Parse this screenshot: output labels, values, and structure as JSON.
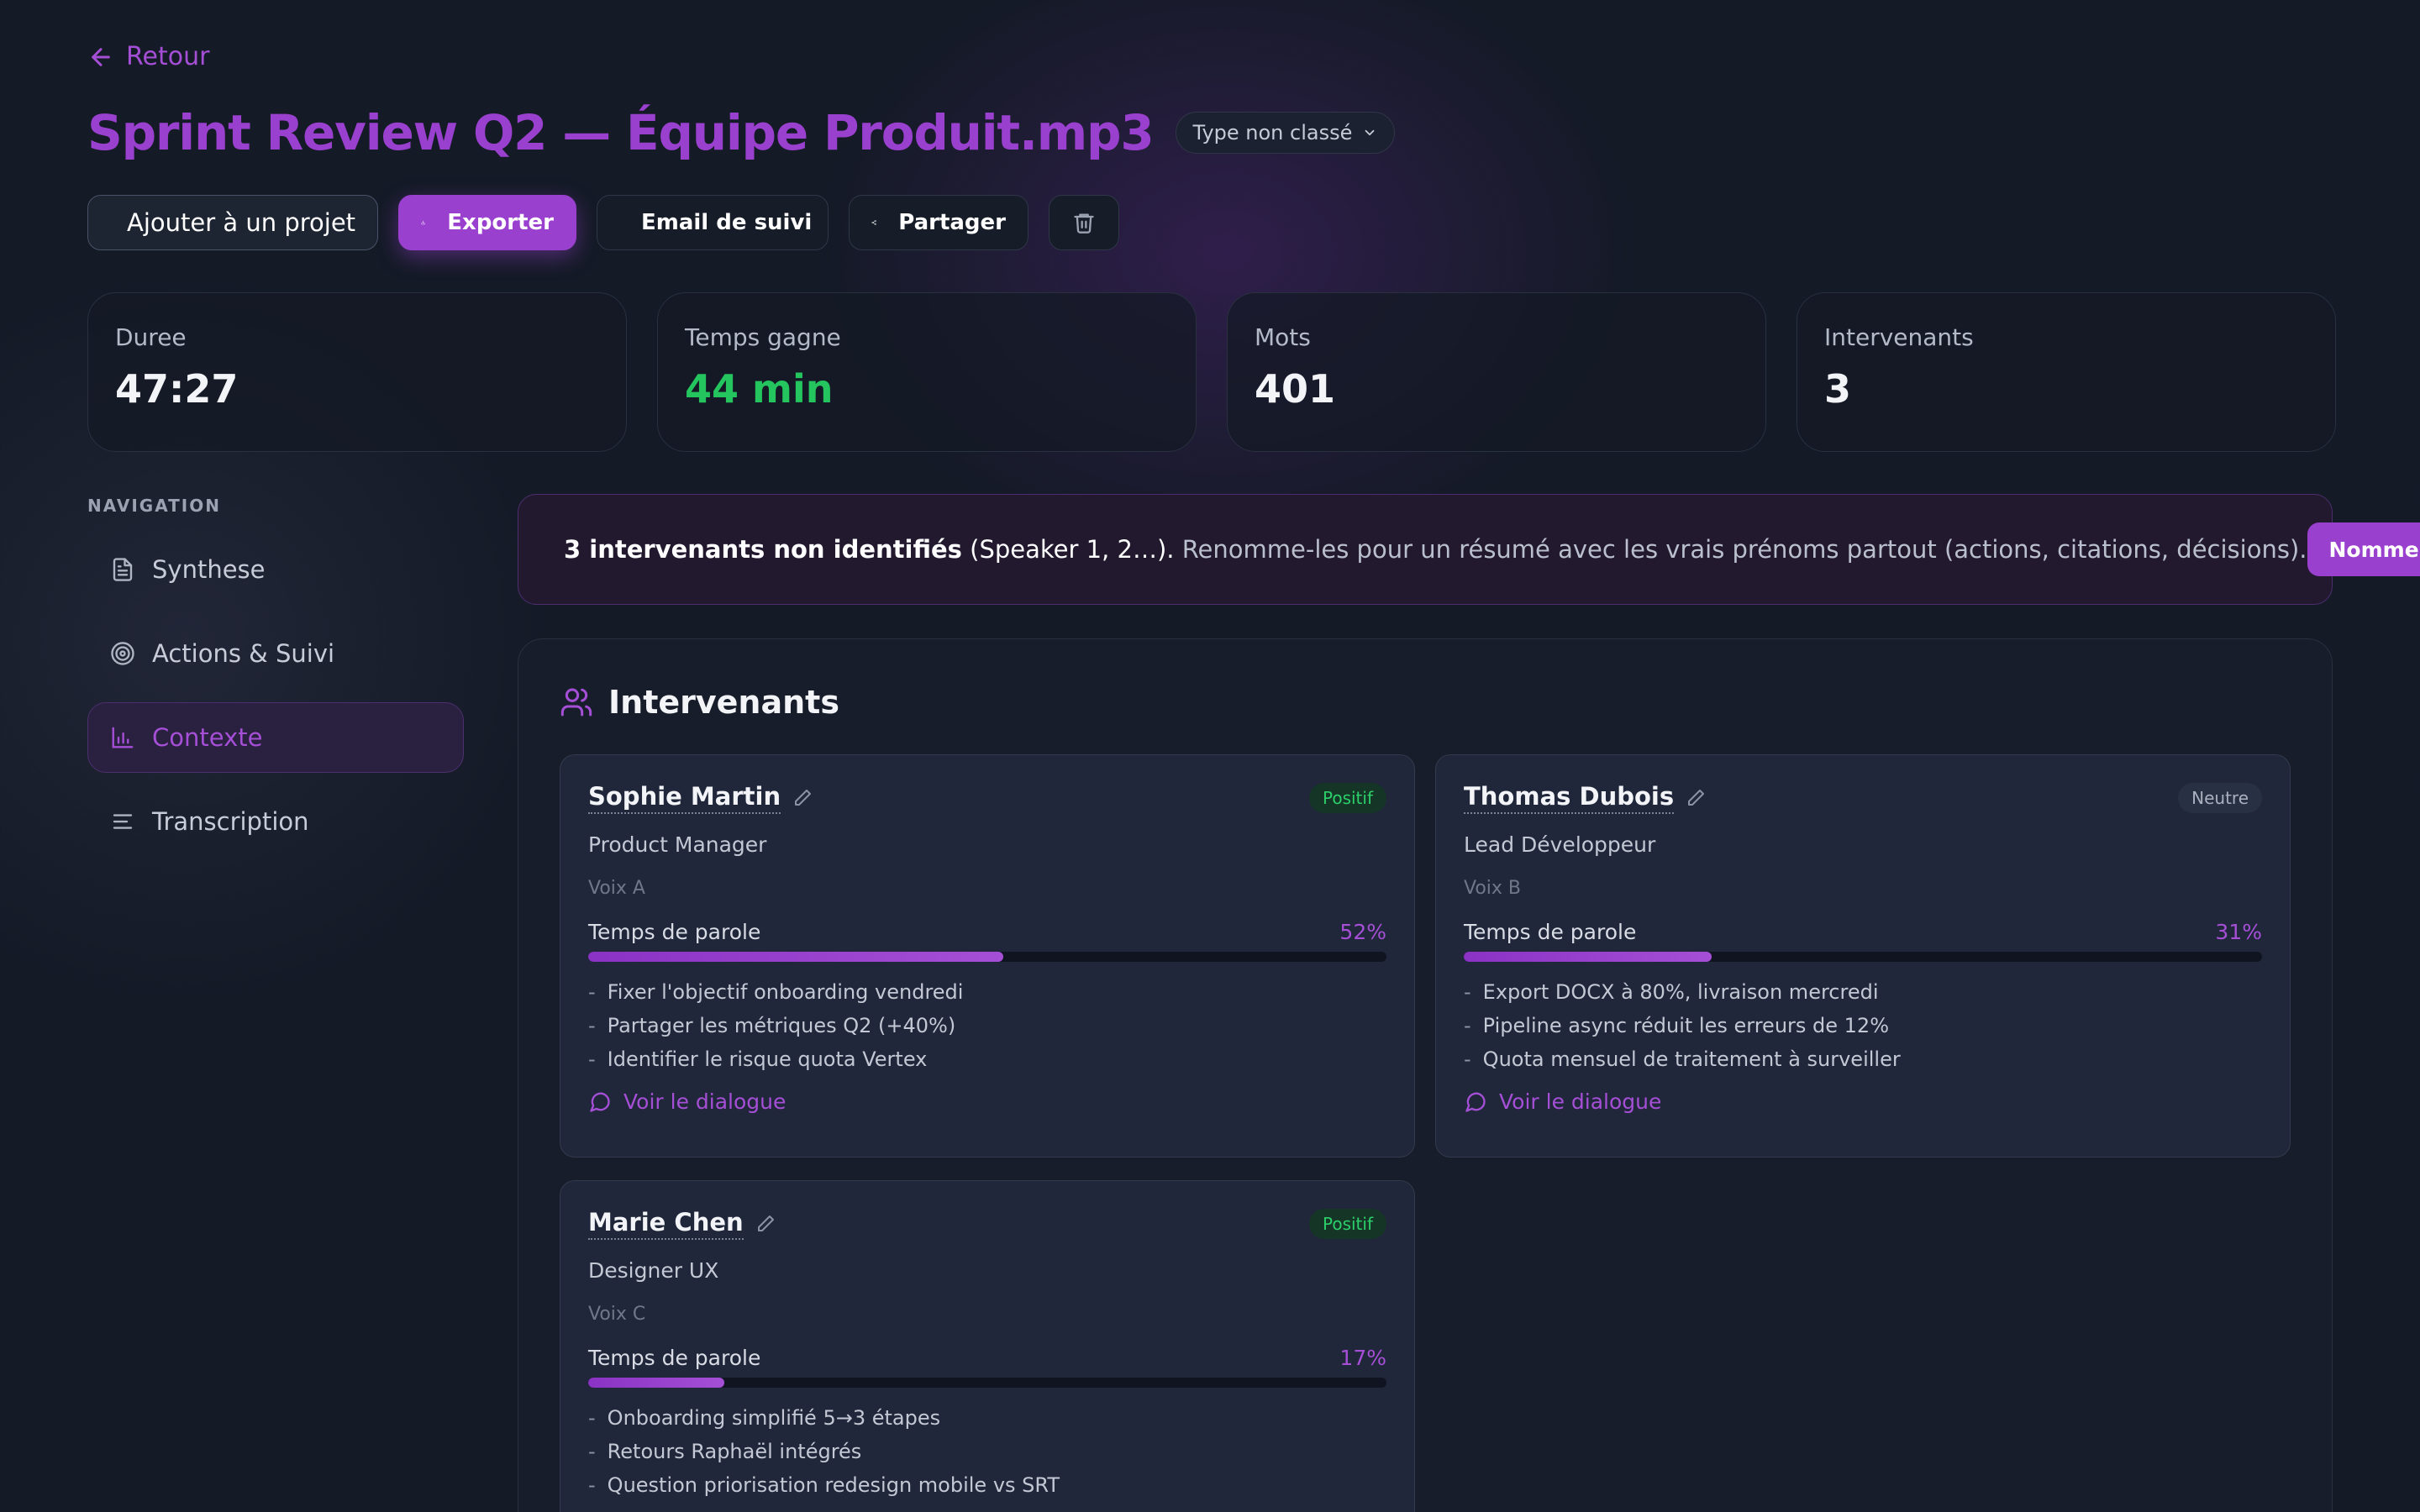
{
  "header": {
    "back_label": "Retour",
    "title": "Sprint Review Q2 — Équipe Produit.mp3",
    "type_select": "Type non classé"
  },
  "toolbar": {
    "add_project_label": "Ajouter à un projet",
    "export_label": "Exporter",
    "email_label": "Email de suivi",
    "share_label": "Partager"
  },
  "stats": [
    {
      "label": "Duree",
      "value": "47:27"
    },
    {
      "label": "Temps gagne",
      "value": "44 min"
    },
    {
      "label": "Mots",
      "value": "401"
    },
    {
      "label": "Intervenants",
      "value": "3"
    }
  ],
  "navigation": {
    "heading": "NAVIGATION",
    "items": [
      {
        "label": "Synthese",
        "icon": "document-icon"
      },
      {
        "label": "Actions & Suivi",
        "icon": "target-icon"
      },
      {
        "label": "Contexte",
        "icon": "bar-chart-icon",
        "active": true
      },
      {
        "label": "Transcription",
        "icon": "lines-icon"
      }
    ]
  },
  "banner": {
    "bold": "3 intervenants non identifiés",
    "highlight": " (Speaker 1, 2…).",
    "rest": " Renomme-les pour un résumé avec les vrais prénoms partout (actions, citations, décisions).",
    "button": "Nommer",
    "close": "×"
  },
  "panel": {
    "title": "Intervenants",
    "talk_label": "Temps de parole",
    "dialog_link": "Voir le dialogue"
  },
  "speakers": [
    {
      "name": "Sophie Martin",
      "role": "Product Manager",
      "voice": "Voix A",
      "sentiment": "Positif",
      "talk_pct": "52%",
      "talk_fraction": 0.52,
      "points": [
        "Fixer l'objectif onboarding vendredi",
        "Partager les métriques Q2 (+40%)",
        "Identifier le risque quota Vertex"
      ]
    },
    {
      "name": "Thomas Dubois",
      "role": "Lead Développeur",
      "voice": "Voix B",
      "sentiment": "Neutre",
      "talk_pct": "31%",
      "talk_fraction": 0.31,
      "points": [
        "Export DOCX à 80%, livraison mercredi",
        "Pipeline async réduit les erreurs de 12%",
        "Quota mensuel de traitement à surveiller"
      ]
    },
    {
      "name": "Marie Chen",
      "role": "Designer UX",
      "voice": "Voix C",
      "sentiment": "Positif",
      "talk_pct": "17%",
      "talk_fraction": 0.17,
      "points": [
        "Onboarding simplifié 5→3 étapes",
        "Retours Raphaël intégrés",
        "Question priorisation redesign mobile vs SRT"
      ]
    }
  ],
  "colors": {
    "accent": "#9a40cf",
    "positive": "#24c45e",
    "background": "#141a26"
  }
}
